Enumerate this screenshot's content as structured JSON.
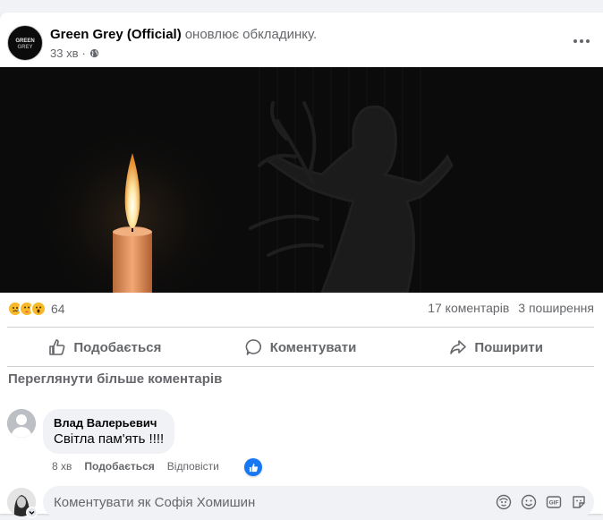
{
  "post": {
    "page_name": "Green Grey (Official)",
    "action": "оновлює обкладинку.",
    "time": "33 хв",
    "separator": "·",
    "avatar_text": "GREEN GREY"
  },
  "stats": {
    "reaction_count": "64",
    "comments": "17 коментарів",
    "shares": "3 поширення"
  },
  "actions": {
    "like": "Подобається",
    "comment": "Коментувати",
    "share": "Поширити"
  },
  "comments": {
    "view_more": "Переглянути більше коментарів",
    "items": [
      {
        "author": "Влад Валерьевич",
        "text": "Світла пам'ять !!!!",
        "time": "8 хв",
        "like_label": "Подобається",
        "reply_label": "Відповісти"
      }
    ]
  },
  "composer": {
    "placeholder": "Коментувати як Софія Хомишин"
  },
  "colors": {
    "accent": "#1877f2",
    "muted": "#65676b",
    "background": "#f0f2f5"
  }
}
